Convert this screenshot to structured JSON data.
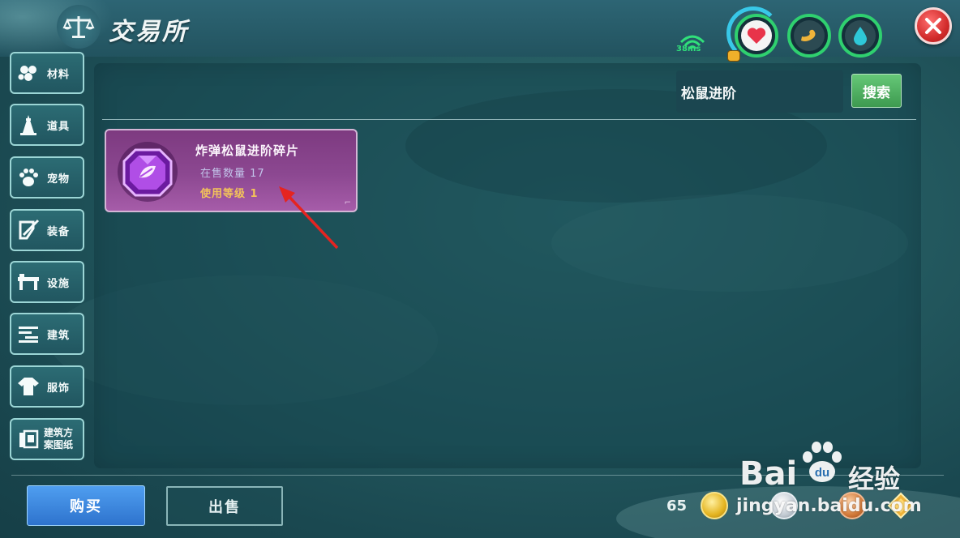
{
  "header": {
    "title": "交易所",
    "title_icon": "scales-icon",
    "ping_label": "38ms",
    "stats": [
      {
        "name": "health",
        "icon": "heart-icon",
        "color": "#e8344a"
      },
      {
        "name": "energy",
        "icon": "arm-icon",
        "color": "#f0b43a"
      },
      {
        "name": "water",
        "icon": "water-drop-icon",
        "color": "#2ec8d8"
      }
    ],
    "close_icon": "close-icon"
  },
  "sidebar": {
    "items": [
      {
        "label": "材料",
        "icon": "materials-icon"
      },
      {
        "label": "道具",
        "icon": "tool-icon"
      },
      {
        "label": "宠物",
        "icon": "paw-icon"
      },
      {
        "label": "装备",
        "icon": "equipment-icon"
      },
      {
        "label": "设施",
        "icon": "facility-icon"
      },
      {
        "label": "建筑",
        "icon": "building-icon"
      },
      {
        "label": "服饰",
        "icon": "clothing-icon"
      },
      {
        "label_line1": "建筑方",
        "label_line2": "案图纸",
        "icon": "blueprint-icon"
      }
    ]
  },
  "search": {
    "value": "松鼠进阶",
    "button_label": "搜索"
  },
  "results": [
    {
      "name": "炸弹松鼠进阶碎片",
      "stock_text": "在售数量 17",
      "level_text": "使用等级 1",
      "icon": "purple-gem-icon",
      "rarity_color": "#8c4891"
    }
  ],
  "footer": {
    "buy_label": "购买",
    "sell_label": "出售",
    "currency_count": "65",
    "currencies": [
      "gold-coin-icon",
      "silver-coin-icon",
      "copper-coin-icon",
      "diamond-icon"
    ]
  },
  "watermark": {
    "brand": "Bai",
    "brand_suffix": "经验",
    "url": "jingyan.baidu.com"
  }
}
